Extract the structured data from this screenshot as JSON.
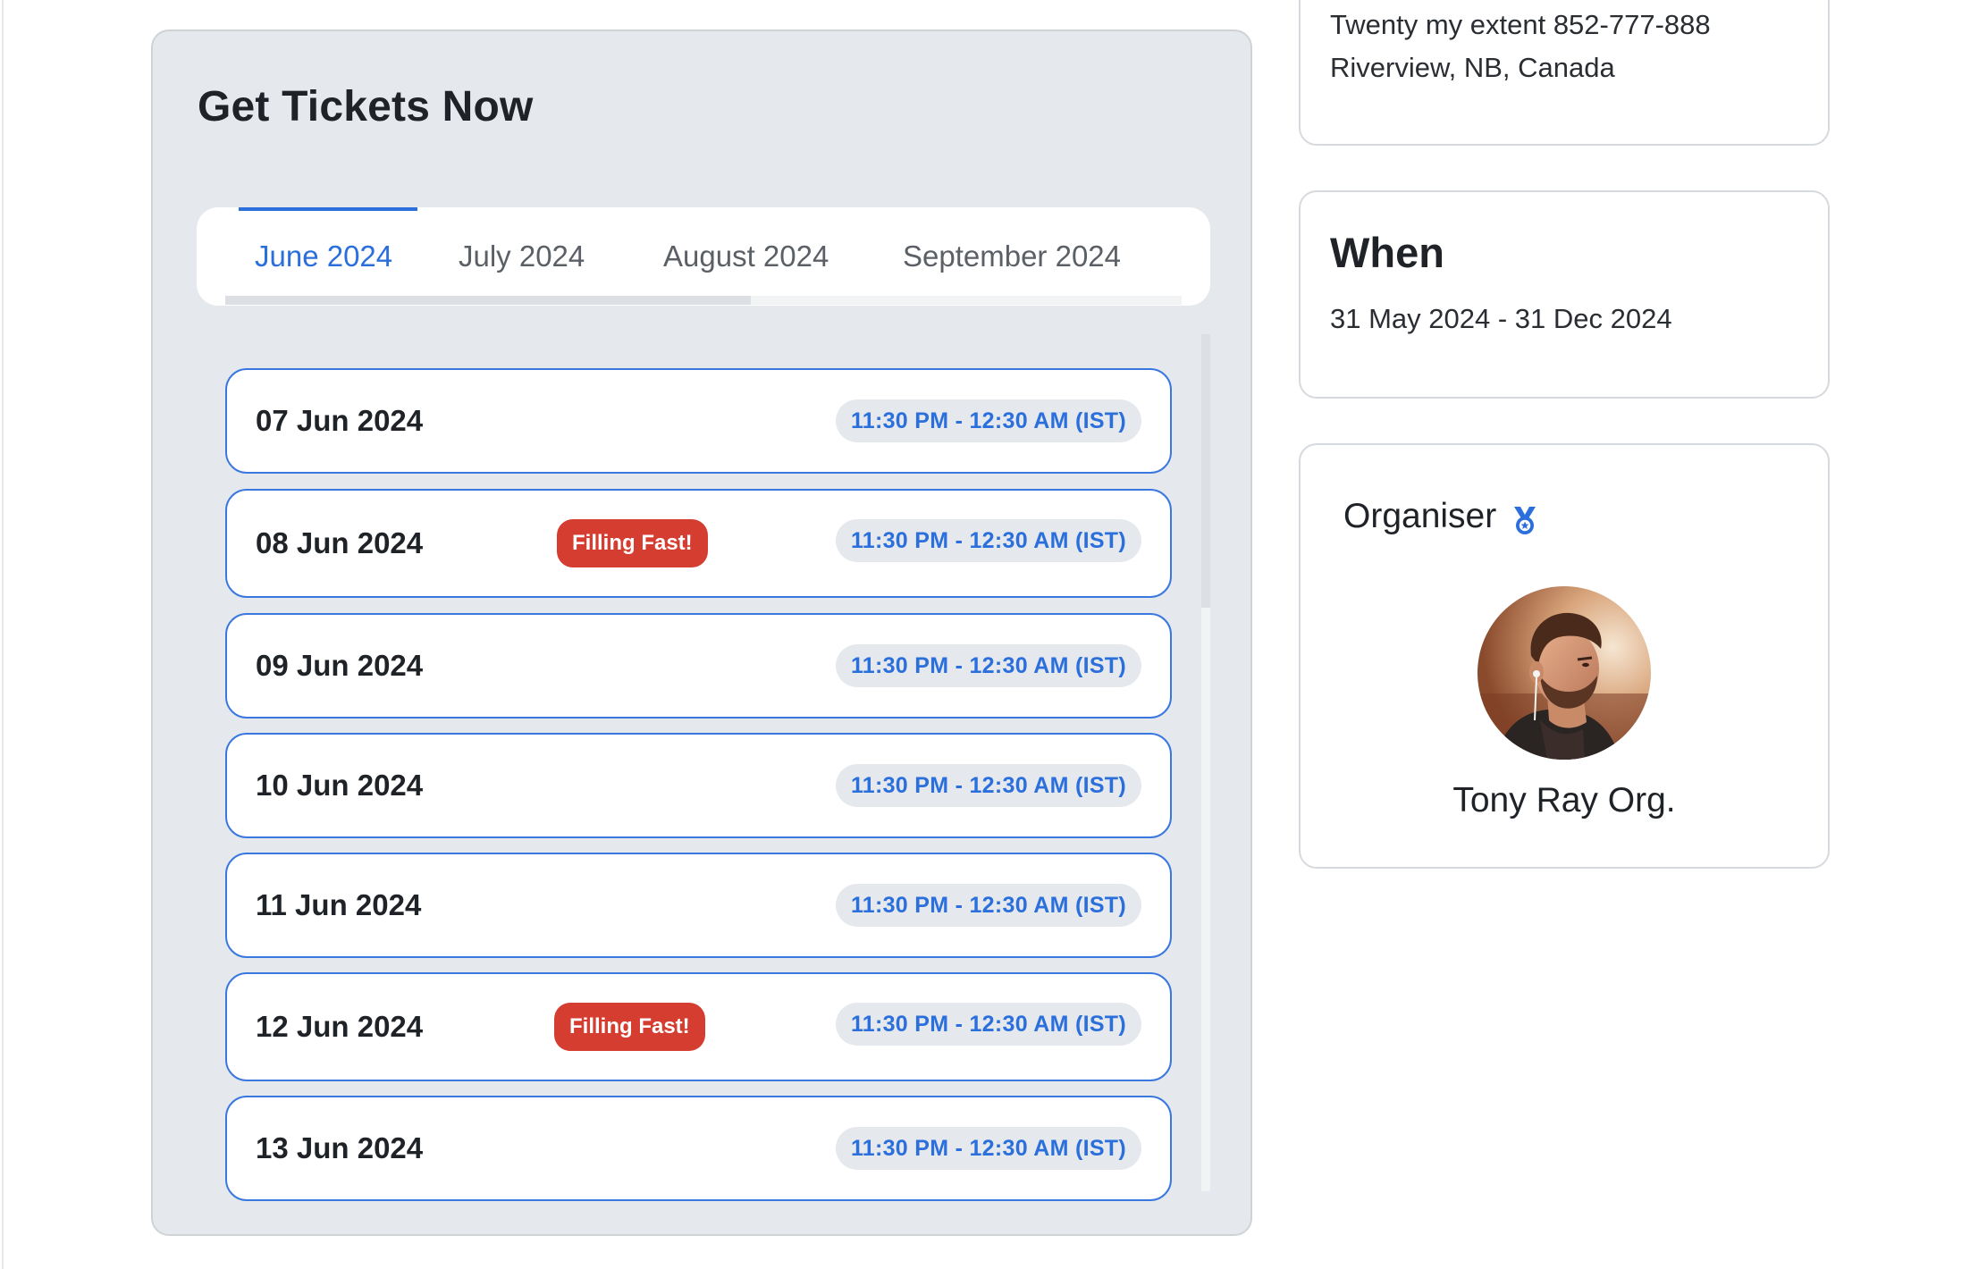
{
  "tickets": {
    "title": "Get Tickets Now",
    "tabs": [
      {
        "label": "June 2024",
        "active": true
      },
      {
        "label": "July 2024",
        "active": false
      },
      {
        "label": "August 2024",
        "active": false
      },
      {
        "label": "September 2024",
        "active": false
      }
    ],
    "dates": [
      {
        "date": "07 Jun 2024",
        "time": "11:30 PM - 12:30 AM (IST)",
        "badge": ""
      },
      {
        "date": "08 Jun 2024",
        "time": "11:30 PM - 12:30 AM (IST)",
        "badge": "Filling Fast!"
      },
      {
        "date": "09 Jun 2024",
        "time": "11:30 PM - 12:30 AM (IST)",
        "badge": ""
      },
      {
        "date": "10 Jun 2024",
        "time": "11:30 PM - 12:30 AM (IST)",
        "badge": ""
      },
      {
        "date": "11 Jun 2024",
        "time": "11:30 PM - 12:30 AM (IST)",
        "badge": ""
      },
      {
        "date": "12 Jun 2024",
        "time": "11:30 PM - 12:30 AM (IST)",
        "badge": "Filling Fast!"
      },
      {
        "date": "13 Jun 2024",
        "time": "11:30 PM - 12:30 AM (IST)",
        "badge": ""
      }
    ]
  },
  "address": {
    "line1": "Twenty my extent 852-777-888",
    "line2": "Riverview, NB, Canada"
  },
  "when": {
    "title": "When",
    "range": "31 May 2024 - 31 Dec 2024"
  },
  "organiser": {
    "title": "Organiser",
    "name": "Tony Ray Org.",
    "badge_icon": "medal-icon"
  },
  "colors": {
    "accent": "#2b6fdc",
    "badge": "#d63d31",
    "card_bg": "#e5e8ec"
  }
}
